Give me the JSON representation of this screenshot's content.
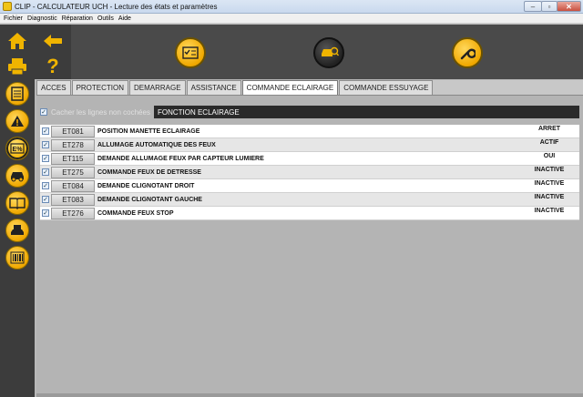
{
  "window": {
    "title": "CLIP - CALCULATEUR UCH - Lecture des états et paramètres"
  },
  "menu": [
    "Fichier",
    "Diagnostic",
    "Réparation",
    "Outils",
    "Aide"
  ],
  "sidebar": {
    "items": [
      {
        "icon": "home-icon"
      },
      {
        "icon": "printer-icon"
      },
      {
        "icon": "calculator-icon"
      },
      {
        "icon": "warning-icon"
      },
      {
        "icon": "states-params-icon",
        "selected": true
      },
      {
        "icon": "car-command-icon"
      },
      {
        "icon": "manual-icon"
      },
      {
        "icon": "car-diagnostic-icon"
      },
      {
        "icon": "barcode-icon"
      }
    ],
    "back_icon": "back-arrow-icon",
    "help_label": "?"
  },
  "toolbar": {
    "buttons": [
      {
        "icon": "checklist-icon"
      },
      {
        "icon": "vehicle-scan-icon"
      },
      {
        "icon": "wrench-icon"
      }
    ]
  },
  "tabs": [
    {
      "label": "ACCES"
    },
    {
      "label": "PROTECTION"
    },
    {
      "label": "DEMARRAGE"
    },
    {
      "label": "ASSISTANCE"
    },
    {
      "label": "COMMANDE ECLAIRAGE",
      "active": true
    },
    {
      "label": "COMMANDE ESSUYAGE"
    }
  ],
  "filter": {
    "hide_unchecked_label": "Cacher les lignes non cochées",
    "section_title": "FONCTION ECLAIRAGE"
  },
  "rows": [
    {
      "code": "ET081",
      "label": "POSITION MANETTE ECLAIRAGE",
      "status": "ARRET"
    },
    {
      "code": "ET278",
      "label": "ALLUMAGE AUTOMATIQUE DES FEUX",
      "status": "ACTIF"
    },
    {
      "code": "ET115",
      "label": "DEMANDE ALLUMAGE FEUX PAR CAPTEUR LUMIERE",
      "status": "OUI"
    },
    {
      "code": "ET275",
      "label": "COMMANDE FEUX DE DETRESSE",
      "status": "INACTIVE"
    },
    {
      "code": "ET084",
      "label": "DEMANDE CLIGNOTANT DROIT",
      "status": "INACTIVE"
    },
    {
      "code": "ET083",
      "label": "DEMANDE CLIGNOTANT GAUCHE",
      "status": "INACTIVE"
    },
    {
      "code": "ET276",
      "label": "COMMANDE FEUX STOP",
      "status": "INACTIVE"
    }
  ],
  "colors": {
    "accent": "#f0a800",
    "sidebar": "#3c3c3c",
    "toolbar": "#4a4a4a"
  }
}
